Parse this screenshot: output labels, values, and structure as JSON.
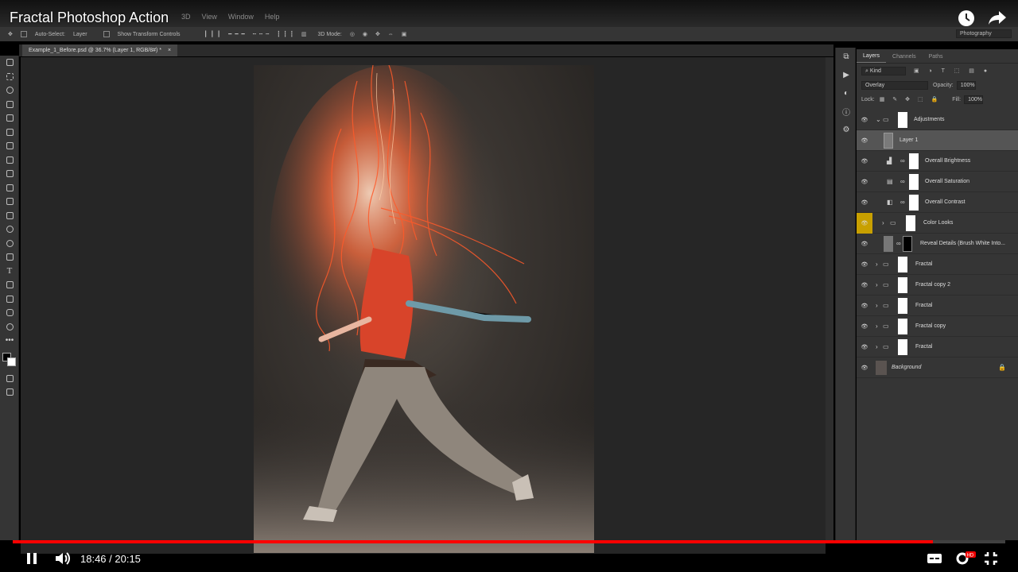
{
  "video": {
    "title": "Fractal Photoshop Action",
    "current_time": "18:46",
    "duration": "20:15",
    "time_display": "18:46 / 20:15",
    "progress": 0.927
  },
  "menu": {
    "items": [
      "3D",
      "View",
      "Window",
      "Help"
    ]
  },
  "options_bar": {
    "auto_select": "Auto-Select:",
    "layer_select": "Layer",
    "show_transform": "Show Transform Controls",
    "mode_3d": "3D Mode:",
    "workspace": "Photography"
  },
  "document": {
    "tab": "Example_1_Before.psd @ 36.7% (Layer 1, RGB/8#) *"
  },
  "layers_panel": {
    "tabs": [
      "Layers",
      "Channels",
      "Paths"
    ],
    "filter": "Kind",
    "blend_mode": "Overlay",
    "opacity_label": "Opacity:",
    "opacity": "100%",
    "lock_label": "Lock:",
    "fill_label": "Fill:",
    "fill": "100%",
    "layers": [
      {
        "name": "Adjustments",
        "kind": "group"
      },
      {
        "name": "Layer 1",
        "kind": "layer",
        "selected": true
      },
      {
        "name": "Overall Brightness",
        "kind": "adjustment"
      },
      {
        "name": "Overall Saturation",
        "kind": "adjustment"
      },
      {
        "name": "Overall Contrast",
        "kind": "adjustment"
      },
      {
        "name": "Color Looks",
        "kind": "group"
      },
      {
        "name": "Reveal Details (Brush White Into...",
        "kind": "layer"
      },
      {
        "name": "Fractal",
        "kind": "group"
      },
      {
        "name": "Fractal copy 2",
        "kind": "group"
      },
      {
        "name": "Fractal",
        "kind": "group"
      },
      {
        "name": "Fractal copy",
        "kind": "group"
      },
      {
        "name": "Fractal",
        "kind": "group"
      },
      {
        "name": "Background",
        "kind": "background"
      }
    ]
  },
  "colors": {
    "accent": "#ff0000",
    "highlight_eye": "#c8a000",
    "panel": "#353535"
  }
}
